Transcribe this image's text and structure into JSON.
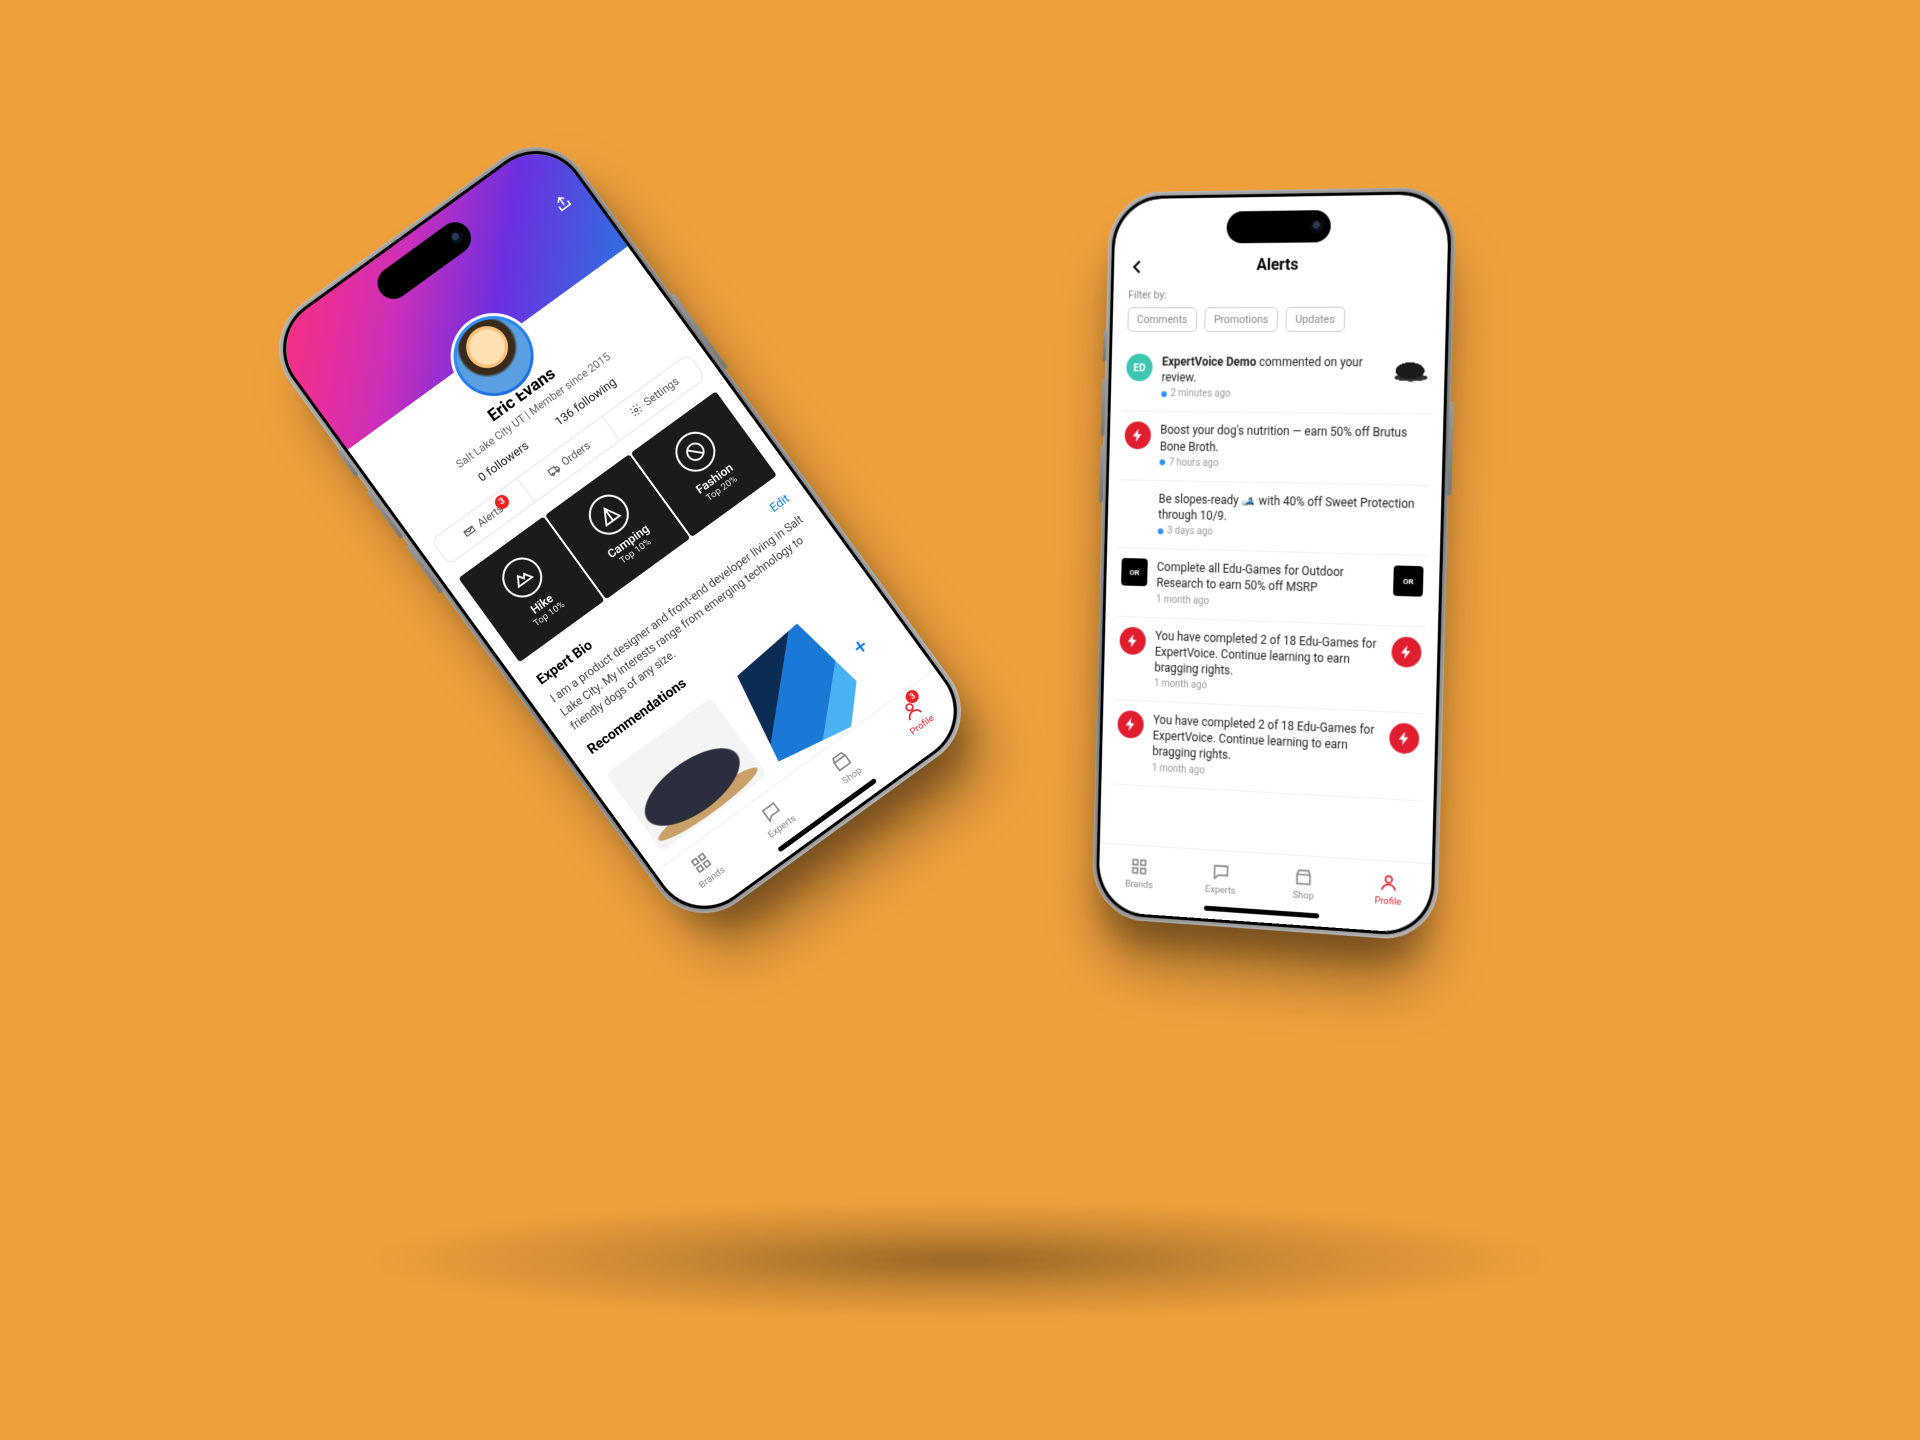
{
  "profile": {
    "name": "Eric Evans",
    "subtitle": "Salt Lake City UT | Member since 2015",
    "followers_label": "0 followers",
    "following_label": "136 following",
    "segments": {
      "alerts": "Alerts",
      "alerts_badge": "3",
      "orders": "Orders",
      "settings": "Settings"
    },
    "tops": [
      {
        "label": "Hike",
        "pct": "Top 10%"
      },
      {
        "label": "Camping",
        "pct": "Top 10%"
      },
      {
        "label": "Fashion",
        "pct": "Top 20%"
      }
    ],
    "bio_heading": "Expert Bio",
    "bio_edit": "Edit",
    "bio_text": "I am a product designer and front-end developer living in Salt Lake City. My interests range from emerging technology to friendly dogs of any size.",
    "recs_heading": "Recommendations"
  },
  "alerts": {
    "title": "Alerts",
    "filter_label": "Filter by:",
    "pills": [
      "Comments",
      "Promotions",
      "Updates"
    ],
    "items": [
      {
        "icon": "ed",
        "bold": "ExpertVoice Demo",
        "text": " commented on your review.",
        "ago": "2 minutes ago",
        "unread": true,
        "thumb": "shoe"
      },
      {
        "icon": "ev",
        "text": "Boost your dog's nutrition — earn 50% off Brutus Bone Broth.",
        "ago": "7 hours ago",
        "unread": true
      },
      {
        "icon": "none",
        "text": "Be slopes-ready 🎿 with 40% off Sweet Protection through 10/9.",
        "ago": "3 days ago",
        "unread": true
      },
      {
        "icon": "or",
        "text": "Complete all Edu-Games for Outdoor Research to earn 50% off MSRP",
        "ago": "1 month ago",
        "unread": false,
        "thumb": "or"
      },
      {
        "icon": "ev",
        "text": "You have completed 2 of 18 Edu-Games for ExpertVoice. Continue learning to earn bragging rights.",
        "ago": "1 month ago",
        "unread": false,
        "thumb": "bolt"
      },
      {
        "icon": "ev",
        "text": "You have completed 2 of 18 Edu-Games for ExpertVoice. Continue learning to earn bragging rights.",
        "ago": "1 month ago",
        "unread": false,
        "thumb": "bolt"
      }
    ]
  },
  "tabs": {
    "brands": "Brands",
    "experts": "Experts",
    "shop": "Shop",
    "profile": "Profile",
    "profile_badge": "3"
  }
}
